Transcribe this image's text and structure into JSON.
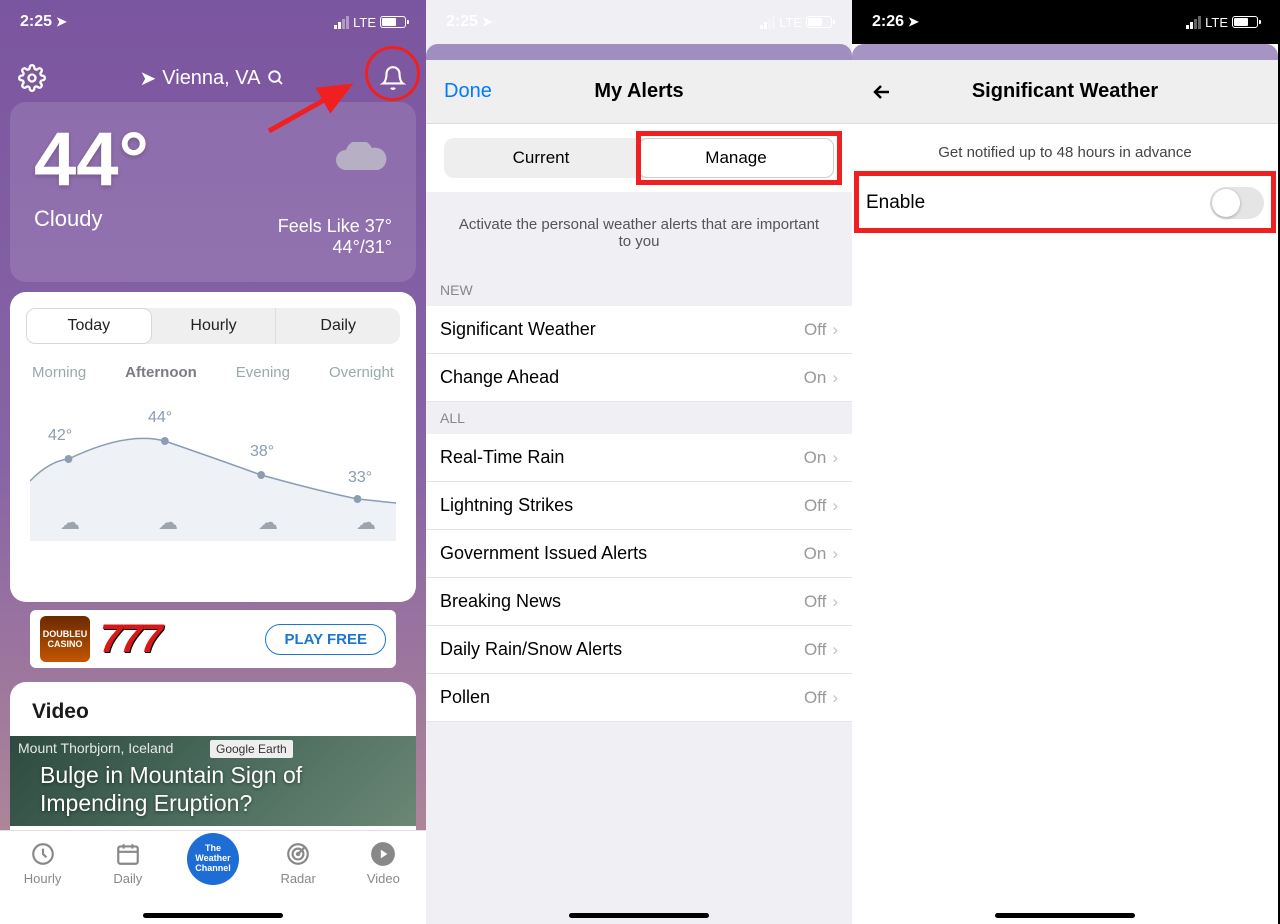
{
  "screen1": {
    "status_time": "2:25",
    "network": "LTE",
    "location": "Vienna, VA",
    "temp": "44°",
    "condition": "Cloudy",
    "feels_like": "Feels Like 37°",
    "hilo": "44°/31°",
    "tabs": [
      "Today",
      "Hourly",
      "Daily"
    ],
    "dayparts": [
      "Morning",
      "Afternoon",
      "Evening",
      "Overnight"
    ],
    "temps": [
      "42°",
      "44°",
      "38°",
      "33°"
    ],
    "ad_cta": "PLAY FREE",
    "ad_sevens": "777",
    "ad_brand": "DOUBLEU CASINO",
    "video_section": "Video",
    "video_loc": "Mount Thorbjorn, Iceland",
    "video_src": "Google Earth",
    "video_headline": "Bulge in Mountain Sign of Impending Eruption?",
    "tabbar": {
      "hourly": "Hourly",
      "daily": "Daily",
      "radar": "Radar",
      "video": "Video"
    },
    "twc": "The Weather Channel"
  },
  "screen2": {
    "status_time": "2:25",
    "network": "LTE",
    "done": "Done",
    "title": "My Alerts",
    "seg": {
      "current": "Current",
      "manage": "Manage"
    },
    "info": "Activate the personal weather alerts that are important to you",
    "section_new": "NEW",
    "section_all": "ALL",
    "rows_new": [
      {
        "label": "Significant Weather",
        "value": "Off"
      },
      {
        "label": "Change Ahead",
        "value": "On"
      }
    ],
    "rows_all": [
      {
        "label": "Real-Time Rain",
        "value": "On"
      },
      {
        "label": "Lightning Strikes",
        "value": "Off"
      },
      {
        "label": "Government Issued Alerts",
        "value": "On"
      },
      {
        "label": "Breaking News",
        "value": "Off"
      },
      {
        "label": "Daily Rain/Snow Alerts",
        "value": "Off"
      },
      {
        "label": "Pollen",
        "value": "Off"
      }
    ]
  },
  "screen3": {
    "status_time": "2:26",
    "network": "LTE",
    "title": "Significant Weather",
    "sub": "Get notified up to 48 hours in advance",
    "enable": "Enable"
  }
}
